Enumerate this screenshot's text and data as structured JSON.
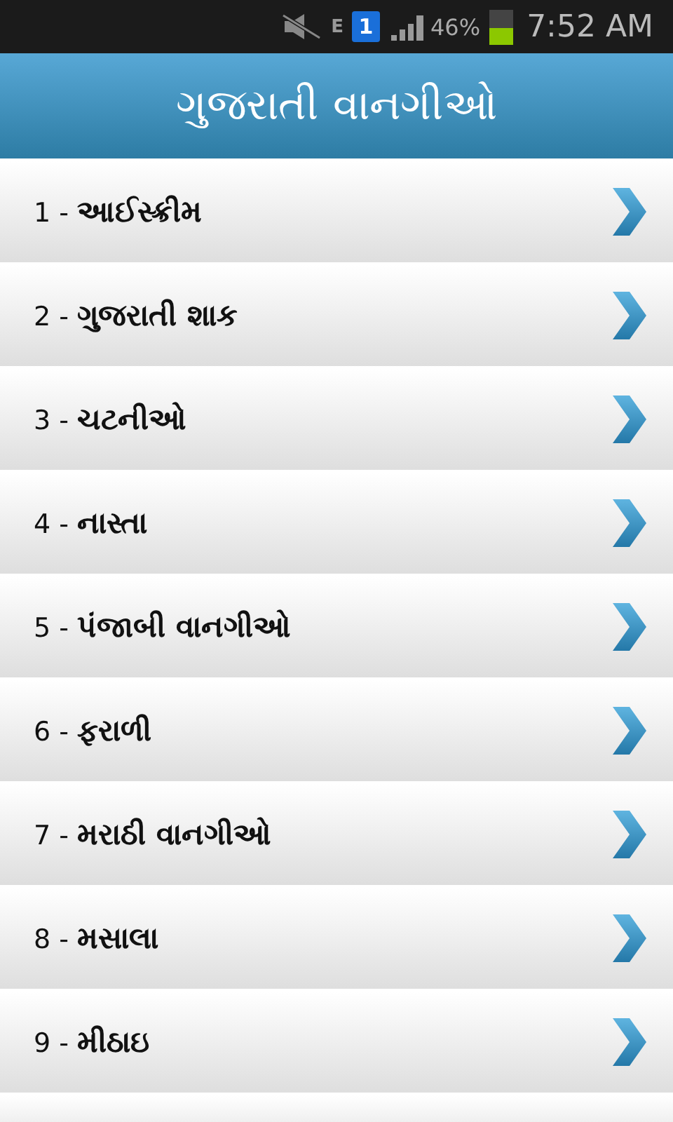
{
  "status_bar": {
    "network_type": "E",
    "sim_badge": "1",
    "battery_percent": "46%",
    "time": "7:52 AM"
  },
  "header": {
    "title": "ગુજરાતી વાનગીઓ"
  },
  "items": [
    {
      "label": "1 - **આઈસ્ક્રીમ**"
    },
    {
      "label": "2 - **ગુજરાતી શાક**"
    },
    {
      "label": "3 - **ચટનીઓ**"
    },
    {
      "label": "4 - **નાસ્તા**"
    },
    {
      "label": "5 - **પંજાબી વાનગીઓ**"
    },
    {
      "label": "6 - **ફરાળી**"
    },
    {
      "label": "7 - **મરાઠી વાનગીઓ**"
    },
    {
      "label": "8 - **મસાલા**"
    },
    {
      "label": "9 - **મીઠાઇ**"
    }
  ]
}
